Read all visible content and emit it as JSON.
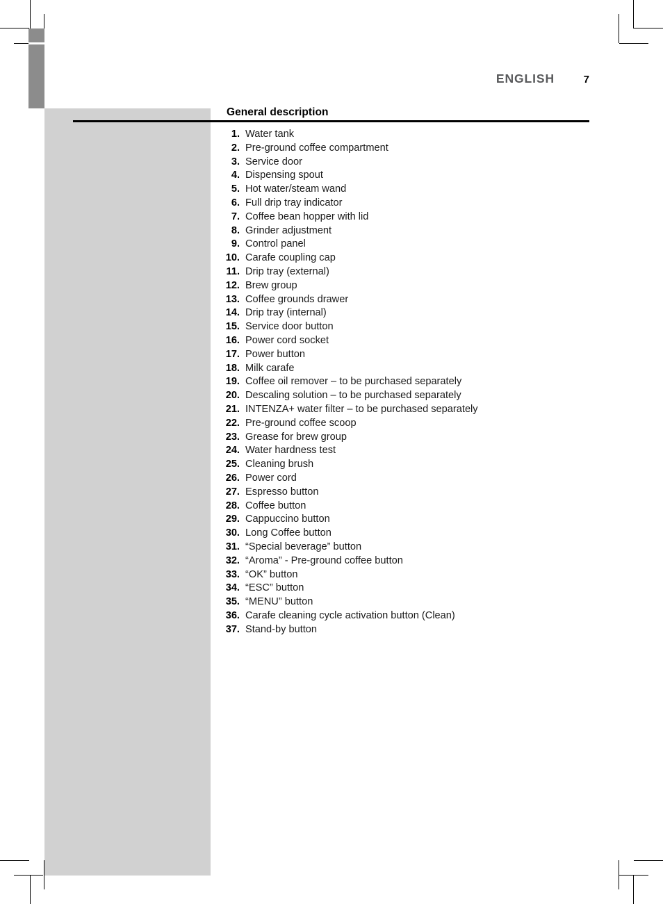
{
  "document": {
    "running_head": {
      "language": "ENGLISH",
      "page_number": "7"
    },
    "section": {
      "heading": "General description"
    }
  },
  "parts_list": [
    {
      "number": "1.",
      "label": "Water tank"
    },
    {
      "number": "2.",
      "label": "Pre-ground coffee compartment"
    },
    {
      "number": "3.",
      "label": "Service door"
    },
    {
      "number": "4.",
      "label": "Dispensing spout"
    },
    {
      "number": "5.",
      "label": "Hot water/steam wand"
    },
    {
      "number": "6.",
      "label": "Full drip tray indicator"
    },
    {
      "number": "7.",
      "label": "Coffee bean hopper with lid"
    },
    {
      "number": "8.",
      "label": "Grinder adjustment"
    },
    {
      "number": "9.",
      "label": "Control panel"
    },
    {
      "number": "10.",
      "label": "Carafe coupling cap"
    },
    {
      "number": "11.",
      "label": "Drip tray (external)"
    },
    {
      "number": "12.",
      "label": "Brew group"
    },
    {
      "number": "13.",
      "label": "Coffee grounds drawer"
    },
    {
      "number": "14.",
      "label": "Drip tray (internal)"
    },
    {
      "number": "15.",
      "label": "Service door button"
    },
    {
      "number": "16.",
      "label": "Power cord socket"
    },
    {
      "number": "17.",
      "label": "Power button"
    },
    {
      "number": "18.",
      "label": "Milk carafe"
    },
    {
      "number": "19.",
      "label": "Coffee oil remover – to be purchased separately"
    },
    {
      "number": "20.",
      "label": "Descaling solution – to be purchased separately"
    },
    {
      "number": "21.",
      "label": "INTENZA+ water filter – to be purchased separately"
    },
    {
      "number": "22.",
      "label": "Pre-ground coffee scoop"
    },
    {
      "number": "23.",
      "label": "Grease for brew group"
    },
    {
      "number": "24.",
      "label": "Water hardness test"
    },
    {
      "number": "25.",
      "label": "Cleaning brush"
    },
    {
      "number": "26.",
      "label": "Power cord"
    },
    {
      "number": "27.",
      "label": "Espresso button"
    },
    {
      "number": "28.",
      "label": "Coffee button"
    },
    {
      "number": "29.",
      "label": "Cappuccino button"
    },
    {
      "number": "30.",
      "label": "Long Coffee button"
    },
    {
      "number": "31.",
      "label": "“Special beverage” button"
    },
    {
      "number": "32.",
      "label": "“Aroma” - Pre-ground coffee button"
    },
    {
      "number": "33.",
      "label": "“OK” button"
    },
    {
      "number": "34.",
      "label": "“ESC” button"
    },
    {
      "number": "35.",
      "label": "“MENU” button"
    },
    {
      "number": "36.",
      "label": "Carafe cleaning cycle activation button (Clean)"
    },
    {
      "number": "37.",
      "label": "Stand-by button"
    }
  ],
  "colors": {
    "thumb_tab": "#8c8c8c",
    "side_panel": "#d1d1d1",
    "running_head_text": "#58595b",
    "rule": "#000000"
  }
}
